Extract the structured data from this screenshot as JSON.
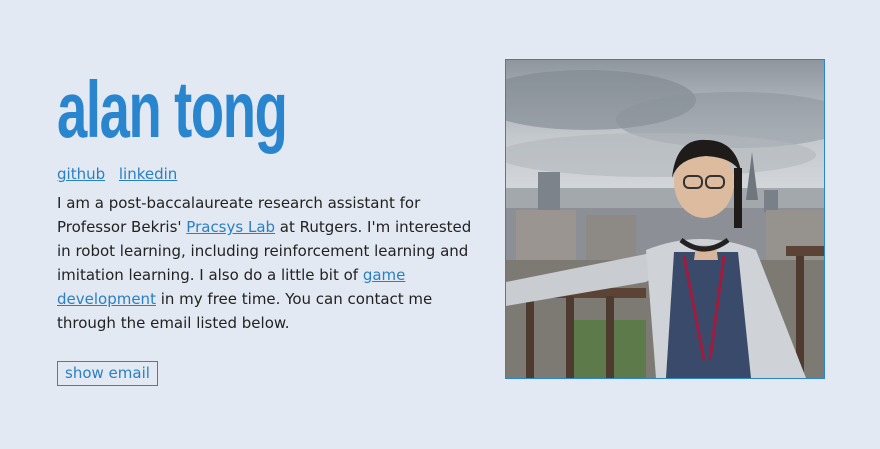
{
  "header": {
    "name": "alan tong"
  },
  "links": [
    {
      "label": "github"
    },
    {
      "label": "linkedin"
    }
  ],
  "bio": {
    "p1": "I am a post-baccalaureate research assistant for Professor Bekris' ",
    "lab_link": "Pracsys Lab",
    "p2": " at Rutgers. I'm interested in robot learning, including reinforcement learning and imitation learning. I also do a little bit of ",
    "game_link": "game development",
    "p3": " in my free time. You can contact me through the email listed below."
  },
  "actions": {
    "show_email": "show email"
  },
  "colors": {
    "accent": "#2a85cf",
    "background": "#e3e9f2"
  }
}
